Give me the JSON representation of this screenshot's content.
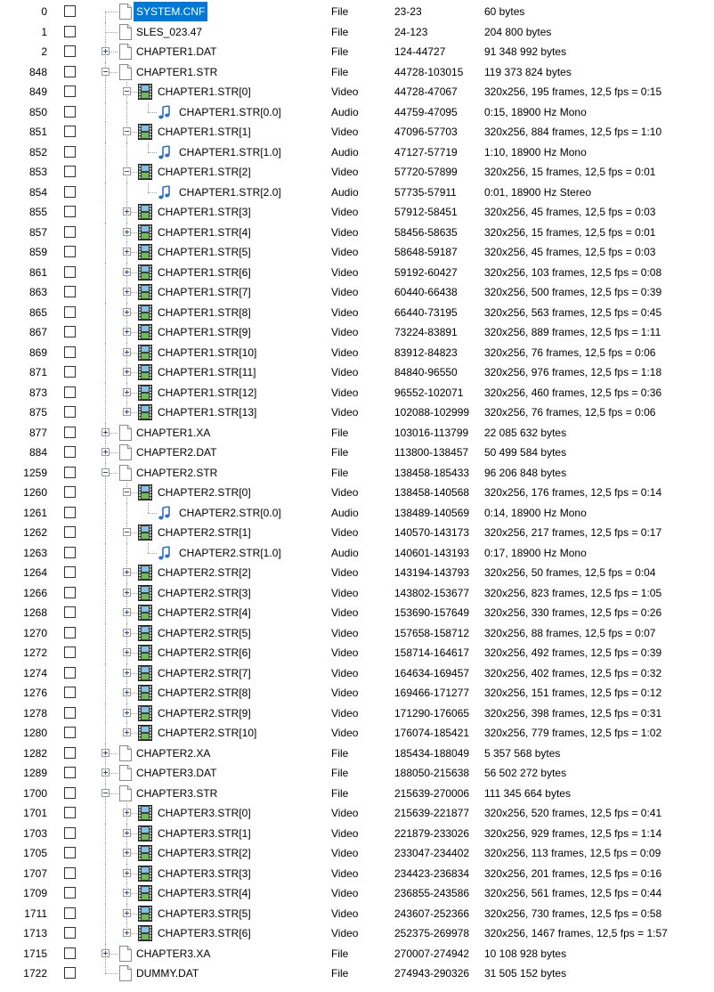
{
  "rows": [
    {
      "num": "0",
      "name": "SYSTEM.CNF",
      "type": "File",
      "range": "23-23",
      "info": "60 bytes",
      "icon": "file-icon",
      "depth": 0,
      "exp": "none",
      "selected": true
    },
    {
      "num": "1",
      "name": "SLES_023.47",
      "type": "File",
      "range": "24-123",
      "info": "204 800 bytes",
      "icon": "file-icon",
      "depth": 0,
      "exp": "none"
    },
    {
      "num": "2",
      "name": "CHAPTER1.DAT",
      "type": "File",
      "range": "124-44727",
      "info": "91 348 992 bytes",
      "icon": "file-icon",
      "depth": 0,
      "exp": "plus"
    },
    {
      "num": "848",
      "name": "CHAPTER1.STR",
      "type": "File",
      "range": "44728-103015",
      "info": "119 373 824 bytes",
      "icon": "file-icon",
      "depth": 0,
      "exp": "minus"
    },
    {
      "num": "849",
      "name": "CHAPTER1.STR[0]",
      "type": "Video",
      "range": "44728-47067",
      "info": "320x256, 195 frames, 12,5 fps = 0:15",
      "icon": "film-icon",
      "depth": 1,
      "exp": "minus"
    },
    {
      "num": "850",
      "name": "CHAPTER1.STR[0.0]",
      "type": "Audio",
      "range": "44759-47095",
      "info": "0:15, 18900 Hz Mono",
      "icon": "music-note-icon",
      "depth": 2,
      "exp": "none"
    },
    {
      "num": "851",
      "name": "CHAPTER1.STR[1]",
      "type": "Video",
      "range": "47096-57703",
      "info": "320x256, 884 frames, 12,5 fps = 1:10",
      "icon": "film-icon",
      "depth": 1,
      "exp": "minus"
    },
    {
      "num": "852",
      "name": "CHAPTER1.STR[1.0]",
      "type": "Audio",
      "range": "47127-57719",
      "info": "1:10, 18900 Hz Mono",
      "icon": "music-note-icon",
      "depth": 2,
      "exp": "none"
    },
    {
      "num": "853",
      "name": "CHAPTER1.STR[2]",
      "type": "Video",
      "range": "57720-57899",
      "info": "320x256, 15 frames, 12,5 fps = 0:01",
      "icon": "film-icon",
      "depth": 1,
      "exp": "minus"
    },
    {
      "num": "854",
      "name": "CHAPTER1.STR[2.0]",
      "type": "Audio",
      "range": "57735-57911",
      "info": "0:01, 18900 Hz Stereo",
      "icon": "music-note-icon",
      "depth": 2,
      "exp": "none"
    },
    {
      "num": "855",
      "name": "CHAPTER1.STR[3]",
      "type": "Video",
      "range": "57912-58451",
      "info": "320x256, 45 frames, 12,5 fps = 0:03",
      "icon": "film-icon",
      "depth": 1,
      "exp": "plus"
    },
    {
      "num": "857",
      "name": "CHAPTER1.STR[4]",
      "type": "Video",
      "range": "58456-58635",
      "info": "320x256, 15 frames, 12,5 fps = 0:01",
      "icon": "film-icon",
      "depth": 1,
      "exp": "plus"
    },
    {
      "num": "859",
      "name": "CHAPTER1.STR[5]",
      "type": "Video",
      "range": "58648-59187",
      "info": "320x256, 45 frames, 12,5 fps = 0:03",
      "icon": "film-icon",
      "depth": 1,
      "exp": "plus"
    },
    {
      "num": "861",
      "name": "CHAPTER1.STR[6]",
      "type": "Video",
      "range": "59192-60427",
      "info": "320x256, 103 frames, 12,5 fps = 0:08",
      "icon": "film-icon",
      "depth": 1,
      "exp": "plus"
    },
    {
      "num": "863",
      "name": "CHAPTER1.STR[7]",
      "type": "Video",
      "range": "60440-66438",
      "info": "320x256, 500 frames, 12,5 fps = 0:39",
      "icon": "film-icon",
      "depth": 1,
      "exp": "plus"
    },
    {
      "num": "865",
      "name": "CHAPTER1.STR[8]",
      "type": "Video",
      "range": "66440-73195",
      "info": "320x256, 563 frames, 12,5 fps = 0:45",
      "icon": "film-icon",
      "depth": 1,
      "exp": "plus"
    },
    {
      "num": "867",
      "name": "CHAPTER1.STR[9]",
      "type": "Video",
      "range": "73224-83891",
      "info": "320x256, 889 frames, 12,5 fps = 1:11",
      "icon": "film-icon",
      "depth": 1,
      "exp": "plus"
    },
    {
      "num": "869",
      "name": "CHAPTER1.STR[10]",
      "type": "Video",
      "range": "83912-84823",
      "info": "320x256, 76 frames, 12,5 fps = 0:06",
      "icon": "film-icon",
      "depth": 1,
      "exp": "plus"
    },
    {
      "num": "871",
      "name": "CHAPTER1.STR[11]",
      "type": "Video",
      "range": "84840-96550",
      "info": "320x256, 976 frames, 12,5 fps = 1:18",
      "icon": "film-icon",
      "depth": 1,
      "exp": "plus"
    },
    {
      "num": "873",
      "name": "CHAPTER1.STR[12]",
      "type": "Video",
      "range": "96552-102071",
      "info": "320x256, 460 frames, 12,5 fps = 0:36",
      "icon": "film-icon",
      "depth": 1,
      "exp": "plus"
    },
    {
      "num": "875",
      "name": "CHAPTER1.STR[13]",
      "type": "Video",
      "range": "102088-102999",
      "info": "320x256, 76 frames, 12,5 fps = 0:06",
      "icon": "film-icon",
      "depth": 1,
      "exp": "plus"
    },
    {
      "num": "877",
      "name": "CHAPTER1.XA",
      "type": "File",
      "range": "103016-113799",
      "info": "22 085 632 bytes",
      "icon": "file-icon",
      "depth": 0,
      "exp": "plus"
    },
    {
      "num": "884",
      "name": "CHAPTER2.DAT",
      "type": "File",
      "range": "113800-138457",
      "info": "50 499 584 bytes",
      "icon": "file-icon",
      "depth": 0,
      "exp": "plus"
    },
    {
      "num": "1259",
      "name": "CHAPTER2.STR",
      "type": "File",
      "range": "138458-185433",
      "info": "96 206 848 bytes",
      "icon": "file-icon",
      "depth": 0,
      "exp": "minus"
    },
    {
      "num": "1260",
      "name": "CHAPTER2.STR[0]",
      "type": "Video",
      "range": "138458-140568",
      "info": "320x256, 176 frames, 12,5 fps = 0:14",
      "icon": "film-icon",
      "depth": 1,
      "exp": "minus"
    },
    {
      "num": "1261",
      "name": "CHAPTER2.STR[0.0]",
      "type": "Audio",
      "range": "138489-140569",
      "info": "0:14, 18900 Hz Mono",
      "icon": "music-note-icon",
      "depth": 2,
      "exp": "none"
    },
    {
      "num": "1262",
      "name": "CHAPTER2.STR[1]",
      "type": "Video",
      "range": "140570-143173",
      "info": "320x256, 217 frames, 12,5 fps = 0:17",
      "icon": "film-icon",
      "depth": 1,
      "exp": "minus"
    },
    {
      "num": "1263",
      "name": "CHAPTER2.STR[1.0]",
      "type": "Audio",
      "range": "140601-143193",
      "info": "0:17, 18900 Hz Mono",
      "icon": "music-note-icon",
      "depth": 2,
      "exp": "none"
    },
    {
      "num": "1264",
      "name": "CHAPTER2.STR[2]",
      "type": "Video",
      "range": "143194-143793",
      "info": "320x256, 50 frames, 12,5 fps = 0:04",
      "icon": "film-icon",
      "depth": 1,
      "exp": "plus"
    },
    {
      "num": "1266",
      "name": "CHAPTER2.STR[3]",
      "type": "Video",
      "range": "143802-153677",
      "info": "320x256, 823 frames, 12,5 fps = 1:05",
      "icon": "film-icon",
      "depth": 1,
      "exp": "plus"
    },
    {
      "num": "1268",
      "name": "CHAPTER2.STR[4]",
      "type": "Video",
      "range": "153690-157649",
      "info": "320x256, 330 frames, 12,5 fps = 0:26",
      "icon": "film-icon",
      "depth": 1,
      "exp": "plus"
    },
    {
      "num": "1270",
      "name": "CHAPTER2.STR[5]",
      "type": "Video",
      "range": "157658-158712",
      "info": "320x256, 88 frames, 12,5 fps = 0:07",
      "icon": "film-icon",
      "depth": 1,
      "exp": "plus"
    },
    {
      "num": "1272",
      "name": "CHAPTER2.STR[6]",
      "type": "Video",
      "range": "158714-164617",
      "info": "320x256, 492 frames, 12,5 fps = 0:39",
      "icon": "film-icon",
      "depth": 1,
      "exp": "plus"
    },
    {
      "num": "1274",
      "name": "CHAPTER2.STR[7]",
      "type": "Video",
      "range": "164634-169457",
      "info": "320x256, 402 frames, 12,5 fps = 0:32",
      "icon": "film-icon",
      "depth": 1,
      "exp": "plus"
    },
    {
      "num": "1276",
      "name": "CHAPTER2.STR[8]",
      "type": "Video",
      "range": "169466-171277",
      "info": "320x256, 151 frames, 12,5 fps = 0:12",
      "icon": "film-icon",
      "depth": 1,
      "exp": "plus"
    },
    {
      "num": "1278",
      "name": "CHAPTER2.STR[9]",
      "type": "Video",
      "range": "171290-176065",
      "info": "320x256, 398 frames, 12,5 fps = 0:31",
      "icon": "film-icon",
      "depth": 1,
      "exp": "plus"
    },
    {
      "num": "1280",
      "name": "CHAPTER2.STR[10]",
      "type": "Video",
      "range": "176074-185421",
      "info": "320x256, 779 frames, 12,5 fps = 1:02",
      "icon": "film-icon",
      "depth": 1,
      "exp": "plus"
    },
    {
      "num": "1282",
      "name": "CHAPTER2.XA",
      "type": "File",
      "range": "185434-188049",
      "info": "5 357 568 bytes",
      "icon": "file-icon",
      "depth": 0,
      "exp": "plus"
    },
    {
      "num": "1289",
      "name": "CHAPTER3.DAT",
      "type": "File",
      "range": "188050-215638",
      "info": "56 502 272 bytes",
      "icon": "file-icon",
      "depth": 0,
      "exp": "plus"
    },
    {
      "num": "1700",
      "name": "CHAPTER3.STR",
      "type": "File",
      "range": "215639-270006",
      "info": "111 345 664 bytes",
      "icon": "file-icon",
      "depth": 0,
      "exp": "minus"
    },
    {
      "num": "1701",
      "name": "CHAPTER3.STR[0]",
      "type": "Video",
      "range": "215639-221877",
      "info": "320x256, 520 frames, 12,5 fps = 0:41",
      "icon": "film-icon",
      "depth": 1,
      "exp": "plus"
    },
    {
      "num": "1703",
      "name": "CHAPTER3.STR[1]",
      "type": "Video",
      "range": "221879-233026",
      "info": "320x256, 929 frames, 12,5 fps = 1:14",
      "icon": "film-icon",
      "depth": 1,
      "exp": "plus"
    },
    {
      "num": "1705",
      "name": "CHAPTER3.STR[2]",
      "type": "Video",
      "range": "233047-234402",
      "info": "320x256, 113 frames, 12,5 fps = 0:09",
      "icon": "film-icon",
      "depth": 1,
      "exp": "plus"
    },
    {
      "num": "1707",
      "name": "CHAPTER3.STR[3]",
      "type": "Video",
      "range": "234423-236834",
      "info": "320x256, 201 frames, 12,5 fps = 0:16",
      "icon": "film-icon",
      "depth": 1,
      "exp": "plus"
    },
    {
      "num": "1709",
      "name": "CHAPTER3.STR[4]",
      "type": "Video",
      "range": "236855-243586",
      "info": "320x256, 561 frames, 12,5 fps = 0:44",
      "icon": "film-icon",
      "depth": 1,
      "exp": "plus"
    },
    {
      "num": "1711",
      "name": "CHAPTER3.STR[5]",
      "type": "Video",
      "range": "243607-252366",
      "info": "320x256, 730 frames, 12,5 fps = 0:58",
      "icon": "film-icon",
      "depth": 1,
      "exp": "plus"
    },
    {
      "num": "1713",
      "name": "CHAPTER3.STR[6]",
      "type": "Video",
      "range": "252375-269978",
      "info": "320x256, 1467 frames, 12,5 fps = 1:57",
      "icon": "film-icon",
      "depth": 1,
      "exp": "plus"
    },
    {
      "num": "1715",
      "name": "CHAPTER3.XA",
      "type": "File",
      "range": "270007-274942",
      "info": "10 108 928 bytes",
      "icon": "file-icon",
      "depth": 0,
      "exp": "plus"
    },
    {
      "num": "1722",
      "name": "DUMMY.DAT",
      "type": "File",
      "range": "274943-290326",
      "info": "31 505 152 bytes",
      "icon": "file-icon",
      "depth": 0,
      "exp": "none"
    }
  ]
}
